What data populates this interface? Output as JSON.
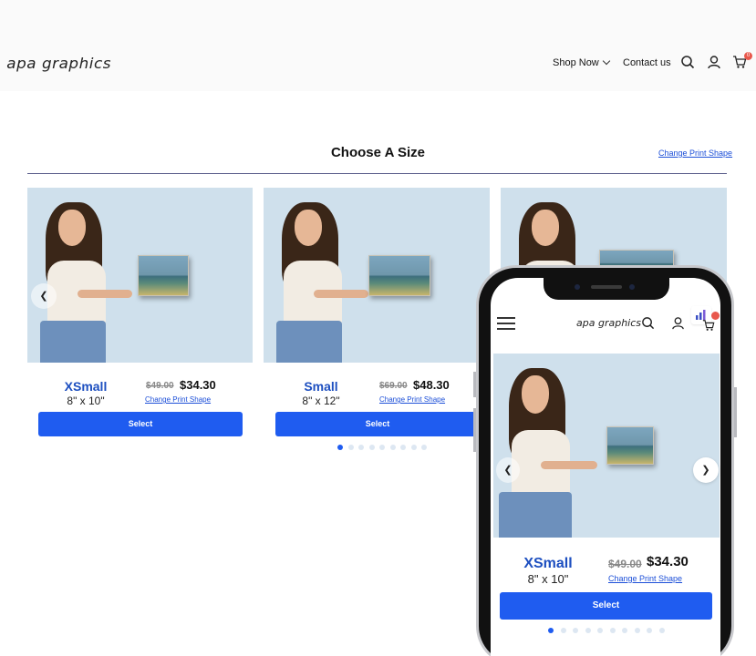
{
  "header": {
    "logo": "apa graphics",
    "nav": {
      "shop_now": "Shop Now",
      "contact_us": "Contact us"
    },
    "cart_count": "0"
  },
  "section": {
    "title": "Choose A Size",
    "change_print_shape": "Change Print Shape"
  },
  "products": [
    {
      "size": "XSmall",
      "dimensions": "8\" x 10\"",
      "old_price": "$49.00",
      "price": "$34.30",
      "change_shape": "Change Print Shape",
      "select": "Select"
    },
    {
      "size": "Small",
      "dimensions": "8\" x 12\"",
      "old_price": "$69.00",
      "price": "$48.30",
      "change_shape": "Change Print Shape",
      "select": "Select"
    }
  ],
  "carousel": {
    "total_dots": 9,
    "active_index": 0
  },
  "mobile": {
    "logo": "apa graphics",
    "product": {
      "size": "XSmall",
      "dimensions": "8\" x 10\"",
      "old_price": "$49.00",
      "price": "$34.30",
      "change_shape": "Change Print Shape",
      "select": "Select"
    },
    "carousel": {
      "total_dots": 10,
      "active_index": 0
    }
  },
  "colors": {
    "accent": "#1f5cf0",
    "size_label": "#1d4fc0",
    "image_bg": "#cfe0ec",
    "badge": "#e8584c"
  }
}
